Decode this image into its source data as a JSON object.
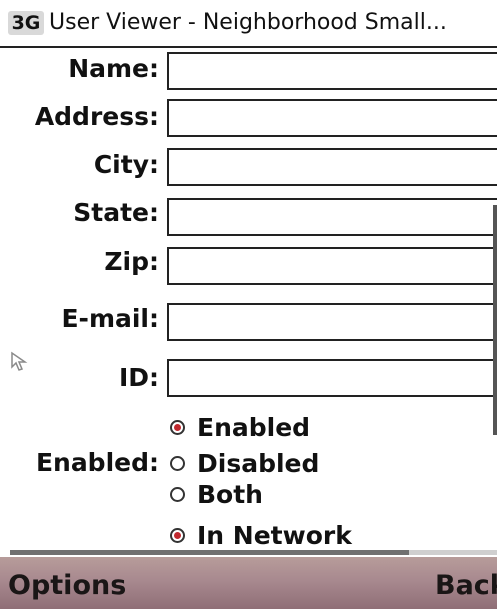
{
  "status": {
    "network": "3G"
  },
  "window": {
    "title": "User Viewer - Neighborhood Small..."
  },
  "form": {
    "fields": [
      {
        "label": "Name:",
        "value": ""
      },
      {
        "label": "Address:",
        "value": ""
      },
      {
        "label": "City:",
        "value": ""
      },
      {
        "label": "State:",
        "value": ""
      },
      {
        "label": "Zip:",
        "value": ""
      },
      {
        "label": "E-mail:",
        "value": ""
      },
      {
        "label": "ID:",
        "value": ""
      }
    ],
    "enabled": {
      "label": "Enabled:",
      "options": [
        {
          "label": "Enabled",
          "selected": true
        },
        {
          "label": "Disabled",
          "selected": false
        },
        {
          "label": "Both",
          "selected": false
        }
      ]
    },
    "network": {
      "options": [
        {
          "label": "In Network",
          "selected": true
        }
      ]
    }
  },
  "scroll": {
    "horizontal_progress": 0.82
  },
  "softkeys": {
    "left": "Options",
    "right": "Back"
  },
  "colors": {
    "radio_selected": "#c0282e",
    "softkey_bg": "#a8898f"
  }
}
